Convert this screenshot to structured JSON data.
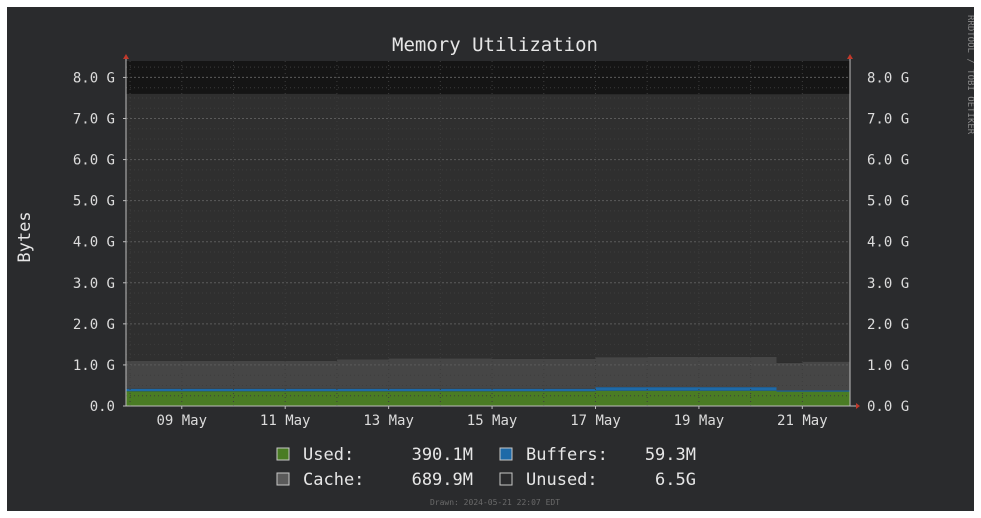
{
  "chart_data": {
    "type": "area",
    "title": "Memory Utilization",
    "ylabel": "Bytes",
    "watermark": "RRDTOOL / TOBI OETIKER",
    "footer": "Drawn: 2024-05-21 22:07 EDT",
    "ylim": [
      0,
      8.4
    ],
    "y_unit": "G",
    "y_ticks": [
      0,
      1,
      2,
      3,
      4,
      5,
      6,
      7,
      8
    ],
    "y_tick_labels": [
      "0.0",
      "1.0 G",
      "2.0 G",
      "3.0 G",
      "4.0 G",
      "5.0 G",
      "6.0 G",
      "7.0 G",
      "8.0 G"
    ],
    "y_tick_labels_right": [
      "0.0 G",
      "1.0 G",
      "2.0 G",
      "3.0 G",
      "4.0 G",
      "5.0 G",
      "6.0 G",
      "7.0 G",
      "8.0 G"
    ],
    "xlim": [
      "2024-05-07T22:07",
      "2024-05-21T22:07"
    ],
    "x_ticks": [
      "2024-05-09T00:00",
      "2024-05-11T00:00",
      "2024-05-13T00:00",
      "2024-05-15T00:00",
      "2024-05-17T00:00",
      "2024-05-19T00:00",
      "2024-05-21T00:00"
    ],
    "x_tick_labels": [
      "09 May",
      "11 May",
      "13 May",
      "15 May",
      "17 May",
      "19 May",
      "21 May"
    ],
    "grid": true,
    "legend_position": "bottom",
    "x": [
      "2024-05-07T22:07",
      "2024-05-09T00:00",
      "2024-05-10T00:00",
      "2024-05-11T00:00",
      "2024-05-12T00:00",
      "2024-05-13T00:00",
      "2024-05-14T00:00",
      "2024-05-15T00:00",
      "2024-05-16T00:00",
      "2024-05-17T00:00",
      "2024-05-18T00:00",
      "2024-05-19T00:00",
      "2024-05-20T00:00",
      "2024-05-20T12:00",
      "2024-05-21T00:00",
      "2024-05-21T22:07"
    ],
    "series": [
      {
        "name": "Used",
        "color": "#4a7c24",
        "values": [
          0.36,
          0.36,
          0.36,
          0.36,
          0.36,
          0.36,
          0.36,
          0.36,
          0.36,
          0.37,
          0.37,
          0.37,
          0.37,
          0.35,
          0.35,
          0.35
        ]
      },
      {
        "name": "Buffers",
        "color": "#1e6aa8",
        "values": [
          0.06,
          0.06,
          0.06,
          0.06,
          0.06,
          0.06,
          0.06,
          0.06,
          0.06,
          0.09,
          0.09,
          0.09,
          0.09,
          0.03,
          0.03,
          0.03
        ]
      },
      {
        "name": "Cache",
        "color": "#464646",
        "values": [
          0.68,
          0.68,
          0.68,
          0.68,
          0.72,
          0.74,
          0.74,
          0.73,
          0.73,
          0.73,
          0.74,
          0.74,
          0.74,
          0.67,
          0.7,
          0.7
        ]
      },
      {
        "name": "Unused",
        "color": "#2f2f2f",
        "values": [
          6.5,
          6.5,
          6.5,
          6.5,
          6.45,
          6.43,
          6.43,
          6.44,
          6.44,
          6.4,
          6.39,
          6.39,
          6.39,
          6.54,
          6.52,
          6.52
        ]
      }
    ],
    "total_memory": 7.6,
    "legend": [
      {
        "name": "Used",
        "label": "Used:",
        "value": "390.1M",
        "color": "#4a7c24"
      },
      {
        "name": "Buffers",
        "label": "Buffers:",
        "value": "59.3M",
        "color": "#1e6aa8"
      },
      {
        "name": "Cache",
        "label": "Cache:",
        "value": "689.9M",
        "color": "#5a5a5a"
      },
      {
        "name": "Unused",
        "label": "Unused:",
        "value": "6.5G",
        "color": "#2a2b2d"
      }
    ]
  }
}
